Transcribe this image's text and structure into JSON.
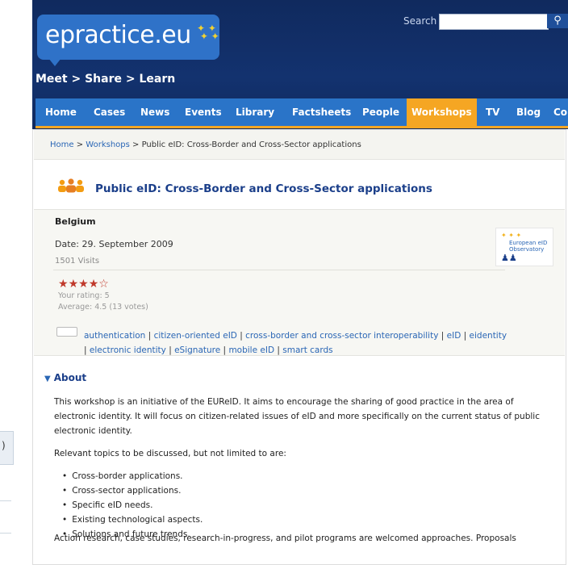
{
  "header": {
    "logo_text": "epractice.eu",
    "tagline": "Meet > Share > Learn",
    "search_label": "Search",
    "search_value": "",
    "search_icon": "magnifier-icon"
  },
  "nav": {
    "items": [
      {
        "label": "Home"
      },
      {
        "label": "Cases"
      },
      {
        "label": "News"
      },
      {
        "label": "Events"
      },
      {
        "label": "Library"
      },
      {
        "label": "Factsheets"
      },
      {
        "label": "People"
      },
      {
        "label": "Workshops",
        "active": true
      },
      {
        "label": "TV"
      },
      {
        "label": "Blog"
      },
      {
        "label": "Co"
      }
    ]
  },
  "breadcrumb": {
    "home": "Home",
    "sep": " > ",
    "workshops": "Workshops",
    "current": "Public eID: Cross-Border and Cross-Sector applications"
  },
  "page": {
    "title": "Public eID: Cross-Border and Cross-Sector applications",
    "country": "Belgium",
    "date": "Date: 29. September 2009",
    "visits": "1501 Visits",
    "partner_logo_line1": "European eID",
    "partner_logo_line2": "Observatory",
    "rating_stars": 4.5,
    "your_rating": "Your rating: 5",
    "average": "Average: 4.5 (13 votes)",
    "tags": [
      "authentication",
      "citizen-oriented eID",
      "cross-border and cross-sector interoperability",
      "eID",
      "eidentity",
      "electronic identity",
      "eSignature",
      "mobile eID",
      "smart cards"
    ]
  },
  "about": {
    "heading": "About",
    "para1": "This workshop is an initiative of the EUReID. It aims to encourage the sharing of good practice in the area of electronic identity. It will focus on citizen-related issues of eID and more specifically on the current status of public electronic identity.",
    "para2": "Relevant topics to be discussed, but not limited to are:",
    "bullets": [
      "Cross-border applications.",
      "Cross-sector applications.",
      "Specific eID needs.",
      "Existing technological aspects.",
      "Solutions and future trends."
    ],
    "para3": "Action research, case studies, research-in-progress, and pilot programs are welcomed approaches. Proposals"
  },
  "left_tab": {
    "glyph": ")"
  }
}
